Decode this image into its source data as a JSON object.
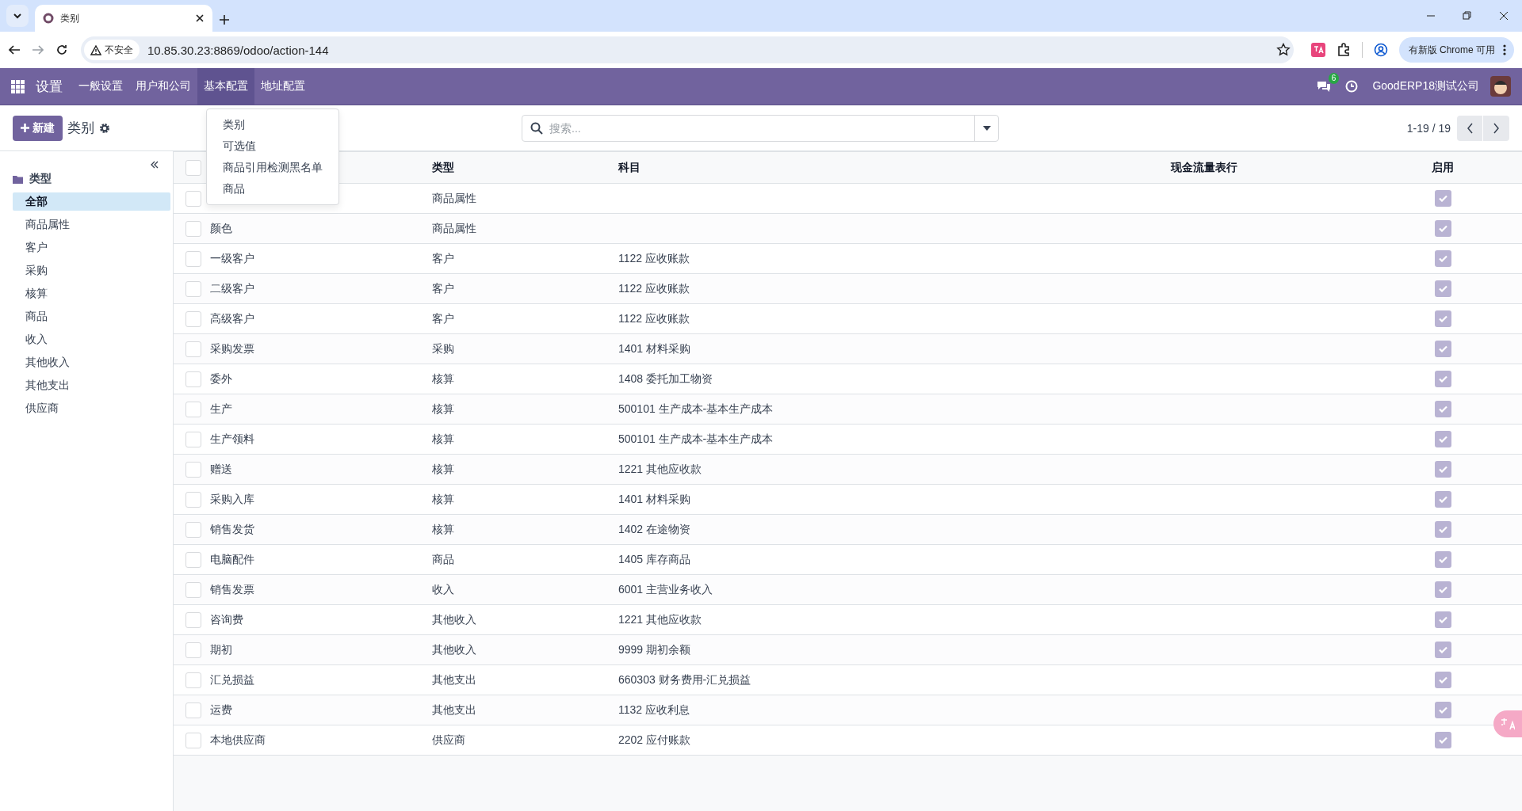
{
  "browser": {
    "tab_title": "类别",
    "security": "不安全",
    "url": "10.85.30.23:8869/odoo/action-144",
    "update_button": "有新版 Chrome 可用"
  },
  "navbar": {
    "app": "设置",
    "menus": [
      {
        "label": "一般设置",
        "selected": false
      },
      {
        "label": "用户和公司",
        "selected": false
      },
      {
        "label": "基本配置",
        "selected": true
      },
      {
        "label": "地址配置",
        "selected": false
      }
    ],
    "dropdown": [
      "类别",
      "可选值",
      "商品引用检测黑名单",
      "商品"
    ],
    "messages_badge": "6",
    "company": "GoodERP18测试公司"
  },
  "control_panel": {
    "new_button": "新建",
    "title": "类别",
    "search": {
      "placeholder": "搜索..."
    },
    "pager": "1-19 / 19"
  },
  "sidebar": {
    "heading": "类型",
    "items": [
      {
        "label": "全部",
        "selected": true
      },
      {
        "label": "商品属性",
        "selected": false
      },
      {
        "label": "客户",
        "selected": false
      },
      {
        "label": "采购",
        "selected": false
      },
      {
        "label": "核算",
        "selected": false
      },
      {
        "label": "商品",
        "selected": false
      },
      {
        "label": "收入",
        "selected": false
      },
      {
        "label": "其他收入",
        "selected": false
      },
      {
        "label": "其他支出",
        "selected": false
      },
      {
        "label": "供应商",
        "selected": false
      }
    ]
  },
  "table": {
    "select_all": false,
    "columns": [
      "类型",
      "科目",
      "现金流量表行",
      "启用"
    ],
    "rows": [
      {
        "type": "商品属性",
        "enabled": true,
        "selected": false
      },
      {
        "name": "颜色",
        "type": "商品属性",
        "enabled": true,
        "selected": false
      },
      {
        "name": "一级客户",
        "type": "客户",
        "account": "1122 应收账款",
        "enabled": true,
        "selected": false
      },
      {
        "name": "二级客户",
        "type": "客户",
        "account": "1122 应收账款",
        "enabled": true,
        "selected": false
      },
      {
        "name": "高级客户",
        "type": "客户",
        "account": "1122 应收账款",
        "enabled": true,
        "selected": false
      },
      {
        "name": "采购发票",
        "type": "采购",
        "account": "1401 材料采购",
        "enabled": true,
        "selected": false
      },
      {
        "name": "委外",
        "type": "核算",
        "account": "1408 委托加工物资",
        "enabled": true,
        "selected": false
      },
      {
        "name": "生产",
        "type": "核算",
        "account": "500101 生产成本-基本生产成本",
        "enabled": true,
        "selected": false
      },
      {
        "name": "生产领料",
        "type": "核算",
        "account": "500101 生产成本-基本生产成本",
        "enabled": true,
        "selected": false
      },
      {
        "name": "赠送",
        "type": "核算",
        "account": "1221 其他应收款",
        "enabled": true,
        "selected": false
      },
      {
        "name": "采购入库",
        "type": "核算",
        "account": "1401 材料采购",
        "enabled": true,
        "selected": false
      },
      {
        "name": "销售发货",
        "type": "核算",
        "account": "1402 在途物资",
        "enabled": true,
        "selected": false
      },
      {
        "name": "电脑配件",
        "type": "商品",
        "account": "1405 库存商品",
        "enabled": true,
        "selected": false
      },
      {
        "name": "销售发票",
        "type": "收入",
        "account": "6001 主营业务收入",
        "enabled": true,
        "selected": false
      },
      {
        "name": "咨询费",
        "type": "其他收入",
        "account": "1221 其他应收款",
        "enabled": true,
        "selected": false
      },
      {
        "name": "期初",
        "type": "其他收入",
        "account": "9999 期初余额",
        "enabled": true,
        "selected": false
      },
      {
        "name": "汇兑损益",
        "type": "其他支出",
        "account": "660303 财务费用-汇兑损益",
        "enabled": true,
        "selected": false
      },
      {
        "name": "运费",
        "type": "其他支出",
        "account": "1132 应收利息",
        "enabled": true,
        "selected": false
      },
      {
        "name": "本地供应商",
        "type": "供应商",
        "account": "2202 应付账款",
        "enabled": true,
        "selected": false
      }
    ]
  }
}
